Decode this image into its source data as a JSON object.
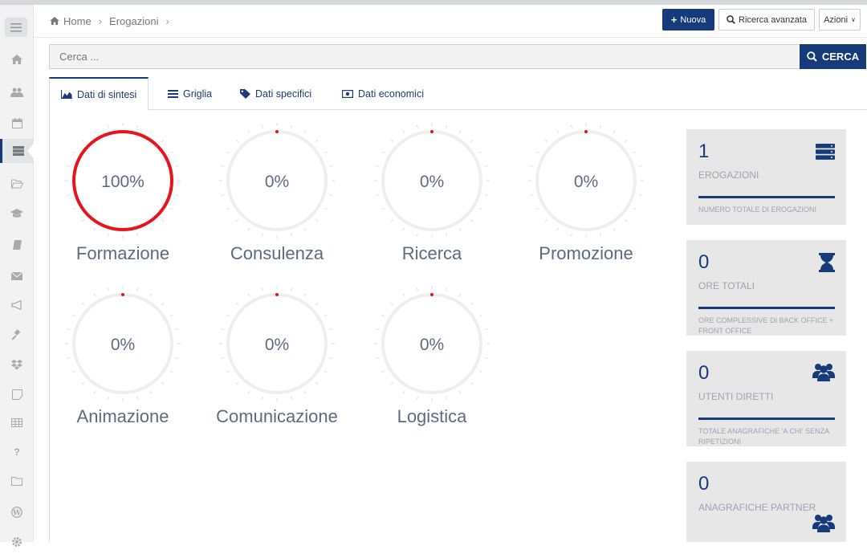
{
  "breadcrumb": {
    "home": "Home",
    "current": "Erogazioni"
  },
  "actions": {
    "nuova": "Nuova",
    "ricerca_avanzata": "Ricerca avanzata",
    "azioni": "Azioni"
  },
  "search": {
    "placeholder": "Cerca ...",
    "button": "CERCA"
  },
  "tabs": [
    {
      "label": "Dati di sintesi",
      "icon": "area-chart-icon"
    },
    {
      "label": "Griglia",
      "icon": "list-icon"
    },
    {
      "label": "Dati specifici",
      "icon": "tag-icon"
    },
    {
      "label": "Dati economici",
      "icon": "money-icon"
    }
  ],
  "gauges": [
    {
      "label": "Formazione",
      "value": "100%",
      "fraction": 1.0
    },
    {
      "label": "Consulenza",
      "value": "0%",
      "fraction": 0
    },
    {
      "label": "Ricerca",
      "value": "0%",
      "fraction": 0
    },
    {
      "label": "Promozione",
      "value": "0%",
      "fraction": 0
    },
    {
      "label": "Animazione",
      "value": "0%",
      "fraction": 0
    },
    {
      "label": "Comunicazione",
      "value": "0%",
      "fraction": 0
    },
    {
      "label": "Logistica",
      "value": "0%",
      "fraction": 0
    }
  ],
  "stats": [
    {
      "number": "1",
      "title": "EROGAZIONI",
      "desc": "NUMERO TOTALE DI EROGAZIONI",
      "icon": "server-icon"
    },
    {
      "number": "0",
      "title": "ORE TOTALI",
      "desc": "ORE COMPLESSIVE DI BACK OFFICE + FRONT OFFICE",
      "icon": "hourglass-icon"
    },
    {
      "number": "0",
      "title": "UTENTI DIRETTI",
      "desc": "TOTALE ANAGRAFICHE 'A CHI' SENZA RIPETIZIONI",
      "icon": "users-icon"
    },
    {
      "number": "0",
      "title": "ANAGRAFICHE PARTNER",
      "desc": "",
      "icon": "users-icon"
    }
  ],
  "colors": {
    "primary": "#163a7a",
    "gauge_active": "#e8141c",
    "gauge_track": "#eeeeee"
  },
  "sidebar_icons": [
    "menu-icon",
    "home-icon",
    "users-icon",
    "calendar-icon",
    "server-icon",
    "folder-open-icon",
    "graduation-cap-icon",
    "book-icon",
    "envelope-icon",
    "bullhorn-icon",
    "gavel-icon",
    "dropbox-icon",
    "sticky-note-icon",
    "table-icon",
    "question-icon",
    "folder-icon",
    "wordpress-icon",
    "gear-icon"
  ]
}
